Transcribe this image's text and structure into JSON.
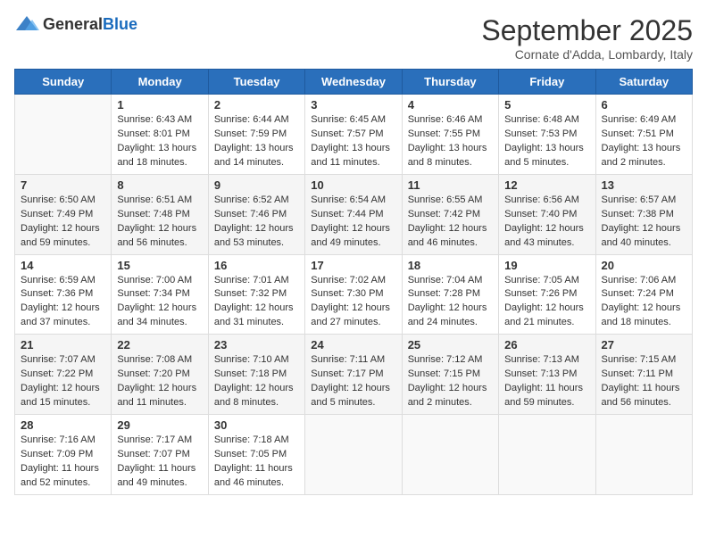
{
  "header": {
    "logo_general": "General",
    "logo_blue": "Blue",
    "month_title": "September 2025",
    "location": "Cornate d'Adda, Lombardy, Italy"
  },
  "days_of_week": [
    "Sunday",
    "Monday",
    "Tuesday",
    "Wednesday",
    "Thursday",
    "Friday",
    "Saturday"
  ],
  "weeks": [
    [
      {
        "day": "",
        "content": ""
      },
      {
        "day": "1",
        "content": "Sunrise: 6:43 AM\nSunset: 8:01 PM\nDaylight: 13 hours\nand 18 minutes."
      },
      {
        "day": "2",
        "content": "Sunrise: 6:44 AM\nSunset: 7:59 PM\nDaylight: 13 hours\nand 14 minutes."
      },
      {
        "day": "3",
        "content": "Sunrise: 6:45 AM\nSunset: 7:57 PM\nDaylight: 13 hours\nand 11 minutes."
      },
      {
        "day": "4",
        "content": "Sunrise: 6:46 AM\nSunset: 7:55 PM\nDaylight: 13 hours\nand 8 minutes."
      },
      {
        "day": "5",
        "content": "Sunrise: 6:48 AM\nSunset: 7:53 PM\nDaylight: 13 hours\nand 5 minutes."
      },
      {
        "day": "6",
        "content": "Sunrise: 6:49 AM\nSunset: 7:51 PM\nDaylight: 13 hours\nand 2 minutes."
      }
    ],
    [
      {
        "day": "7",
        "content": "Sunrise: 6:50 AM\nSunset: 7:49 PM\nDaylight: 12 hours\nand 59 minutes."
      },
      {
        "day": "8",
        "content": "Sunrise: 6:51 AM\nSunset: 7:48 PM\nDaylight: 12 hours\nand 56 minutes."
      },
      {
        "day": "9",
        "content": "Sunrise: 6:52 AM\nSunset: 7:46 PM\nDaylight: 12 hours\nand 53 minutes."
      },
      {
        "day": "10",
        "content": "Sunrise: 6:54 AM\nSunset: 7:44 PM\nDaylight: 12 hours\nand 49 minutes."
      },
      {
        "day": "11",
        "content": "Sunrise: 6:55 AM\nSunset: 7:42 PM\nDaylight: 12 hours\nand 46 minutes."
      },
      {
        "day": "12",
        "content": "Sunrise: 6:56 AM\nSunset: 7:40 PM\nDaylight: 12 hours\nand 43 minutes."
      },
      {
        "day": "13",
        "content": "Sunrise: 6:57 AM\nSunset: 7:38 PM\nDaylight: 12 hours\nand 40 minutes."
      }
    ],
    [
      {
        "day": "14",
        "content": "Sunrise: 6:59 AM\nSunset: 7:36 PM\nDaylight: 12 hours\nand 37 minutes."
      },
      {
        "day": "15",
        "content": "Sunrise: 7:00 AM\nSunset: 7:34 PM\nDaylight: 12 hours\nand 34 minutes."
      },
      {
        "day": "16",
        "content": "Sunrise: 7:01 AM\nSunset: 7:32 PM\nDaylight: 12 hours\nand 31 minutes."
      },
      {
        "day": "17",
        "content": "Sunrise: 7:02 AM\nSunset: 7:30 PM\nDaylight: 12 hours\nand 27 minutes."
      },
      {
        "day": "18",
        "content": "Sunrise: 7:04 AM\nSunset: 7:28 PM\nDaylight: 12 hours\nand 24 minutes."
      },
      {
        "day": "19",
        "content": "Sunrise: 7:05 AM\nSunset: 7:26 PM\nDaylight: 12 hours\nand 21 minutes."
      },
      {
        "day": "20",
        "content": "Sunrise: 7:06 AM\nSunset: 7:24 PM\nDaylight: 12 hours\nand 18 minutes."
      }
    ],
    [
      {
        "day": "21",
        "content": "Sunrise: 7:07 AM\nSunset: 7:22 PM\nDaylight: 12 hours\nand 15 minutes."
      },
      {
        "day": "22",
        "content": "Sunrise: 7:08 AM\nSunset: 7:20 PM\nDaylight: 12 hours\nand 11 minutes."
      },
      {
        "day": "23",
        "content": "Sunrise: 7:10 AM\nSunset: 7:18 PM\nDaylight: 12 hours\nand 8 minutes."
      },
      {
        "day": "24",
        "content": "Sunrise: 7:11 AM\nSunset: 7:17 PM\nDaylight: 12 hours\nand 5 minutes."
      },
      {
        "day": "25",
        "content": "Sunrise: 7:12 AM\nSunset: 7:15 PM\nDaylight: 12 hours\nand 2 minutes."
      },
      {
        "day": "26",
        "content": "Sunrise: 7:13 AM\nSunset: 7:13 PM\nDaylight: 11 hours\nand 59 minutes."
      },
      {
        "day": "27",
        "content": "Sunrise: 7:15 AM\nSunset: 7:11 PM\nDaylight: 11 hours\nand 56 minutes."
      }
    ],
    [
      {
        "day": "28",
        "content": "Sunrise: 7:16 AM\nSunset: 7:09 PM\nDaylight: 11 hours\nand 52 minutes."
      },
      {
        "day": "29",
        "content": "Sunrise: 7:17 AM\nSunset: 7:07 PM\nDaylight: 11 hours\nand 49 minutes."
      },
      {
        "day": "30",
        "content": "Sunrise: 7:18 AM\nSunset: 7:05 PM\nDaylight: 11 hours\nand 46 minutes."
      },
      {
        "day": "",
        "content": ""
      },
      {
        "day": "",
        "content": ""
      },
      {
        "day": "",
        "content": ""
      },
      {
        "day": "",
        "content": ""
      }
    ]
  ]
}
